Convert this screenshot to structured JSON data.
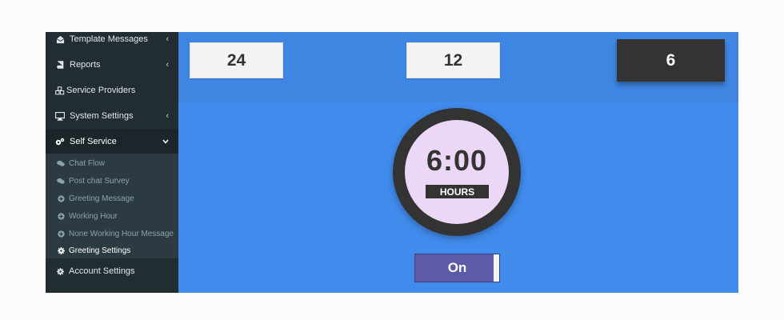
{
  "sidebar": {
    "items": [
      {
        "label": "Template Messages",
        "icon": "envelope-open-icon",
        "chevron": "‹"
      },
      {
        "label": "Reports",
        "icon": "book-icon",
        "chevron": "‹"
      },
      {
        "label": "Service Providers",
        "icon": "cubes-icon"
      },
      {
        "label": "System Settings",
        "icon": "desktop-icon",
        "chevron": "‹"
      },
      {
        "label": "Self Service",
        "icon": "cogs-icon",
        "chevron": "⌄"
      }
    ],
    "sub_items": [
      {
        "label": "Chat Flow",
        "icon": "comments-icon"
      },
      {
        "label": "Post chat Survey",
        "icon": "comments-icon"
      },
      {
        "label": "Greeting Message",
        "icon": "plus-circle-icon"
      },
      {
        "label": "Working Hour",
        "icon": "plus-circle-icon"
      },
      {
        "label": "None Working Hour Message",
        "icon": "plus-circle-icon"
      },
      {
        "label": "Greeting Settings",
        "icon": "gear-icon"
      }
    ],
    "footer_item": {
      "label": "Account Settings",
      "icon": "gear-icon"
    }
  },
  "hour_options": [
    "24",
    "12",
    "6"
  ],
  "selected_hours": "6",
  "clock": {
    "time": "6:00",
    "unit": "HOURS"
  },
  "toggle": {
    "label": "On"
  },
  "colors": {
    "sidebar_bg": "#222d32",
    "submenu_bg": "#2c3b41",
    "main_bg": "#418bec",
    "clock_face": "#ecd8f6",
    "toggle_bg": "#5d5aa8"
  }
}
